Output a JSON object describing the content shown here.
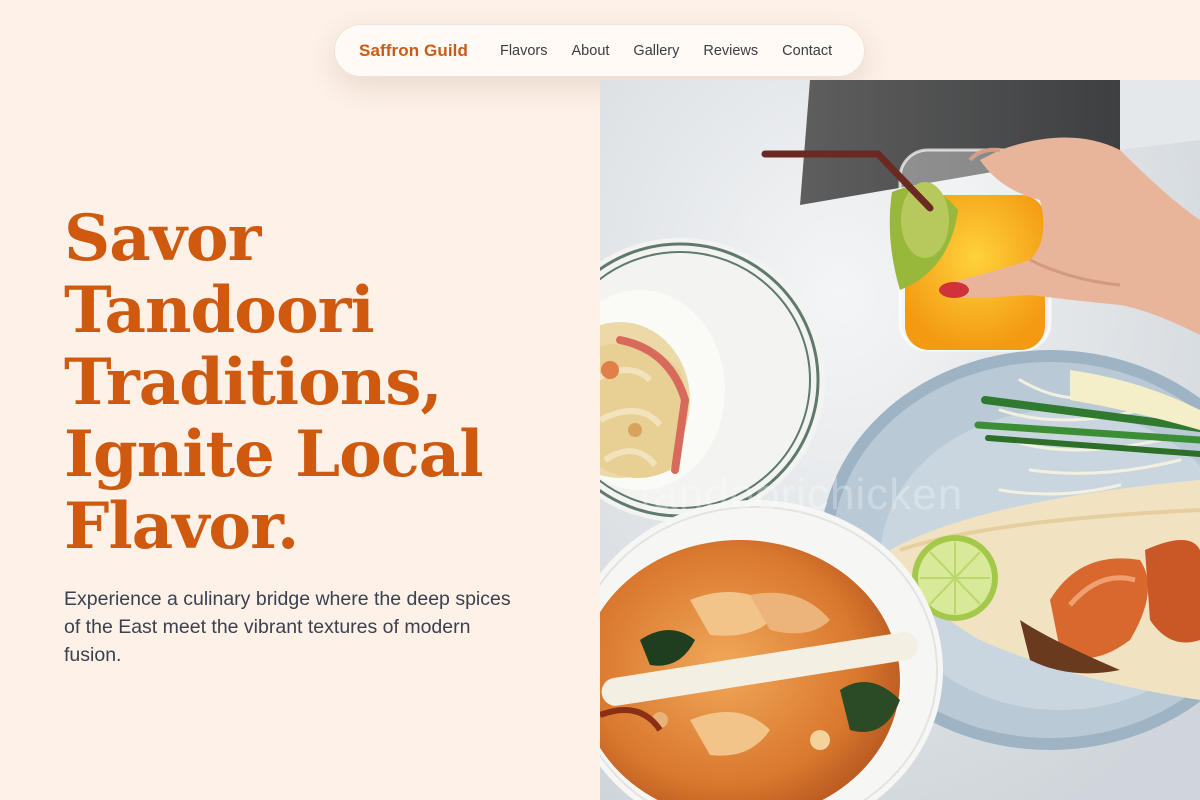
{
  "nav": {
    "brand": "Saffron Guild",
    "links": [
      "Flavors",
      "About",
      "Gallery",
      "Reviews",
      "Contact"
    ]
  },
  "hero": {
    "title": "Savor Tandoori Traditions, Ignite Local Flavor.",
    "subtitle": "Experience a culinary bridge where the deep spices of the East meet the vibrant textures of modern fusion."
  },
  "image": {
    "alt": "table with pasta, tom yum soup, pad thai crepe with prawns and a glass of orange juice",
    "watermark": "tandoorichicken"
  },
  "colors": {
    "accent": "#cf5a0f",
    "background": "#fdf1e8",
    "body_text": "#3b4150"
  }
}
